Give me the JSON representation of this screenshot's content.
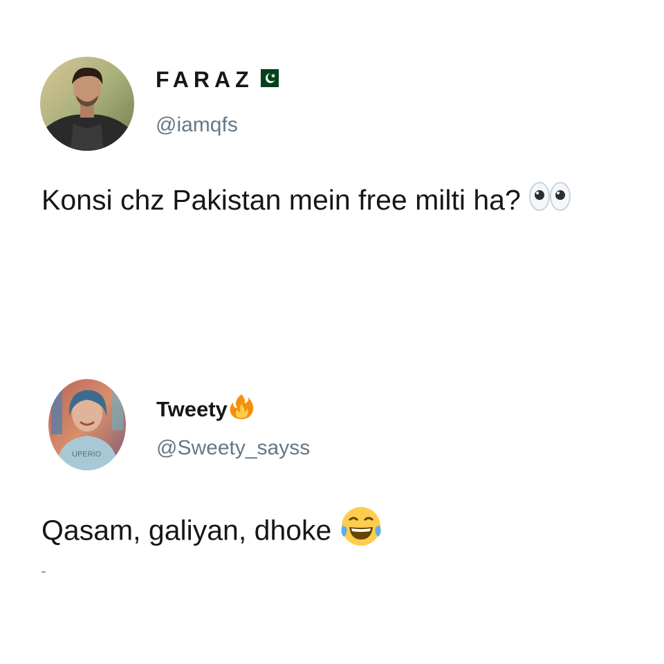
{
  "tweets": [
    {
      "display_name": "FARAZ",
      "handle": "@iamqfs",
      "text": "Konsi chz Pakistan mein free milti ha?",
      "name_badge_icon": "pakistan-flag-icon",
      "text_emoji_icon": "eyes-emoji-icon"
    },
    {
      "display_name": "Tweety",
      "handle": "@Sweety_sayss",
      "text": "Qasam, galiyan, dhoke",
      "name_badge_icon": "fire-emoji-icon",
      "text_emoji_icon": "tears-of-joy-emoji-icon"
    }
  ],
  "colors": {
    "text_primary": "#14171a",
    "text_secondary": "#657786",
    "flag_green": "#01411c"
  }
}
